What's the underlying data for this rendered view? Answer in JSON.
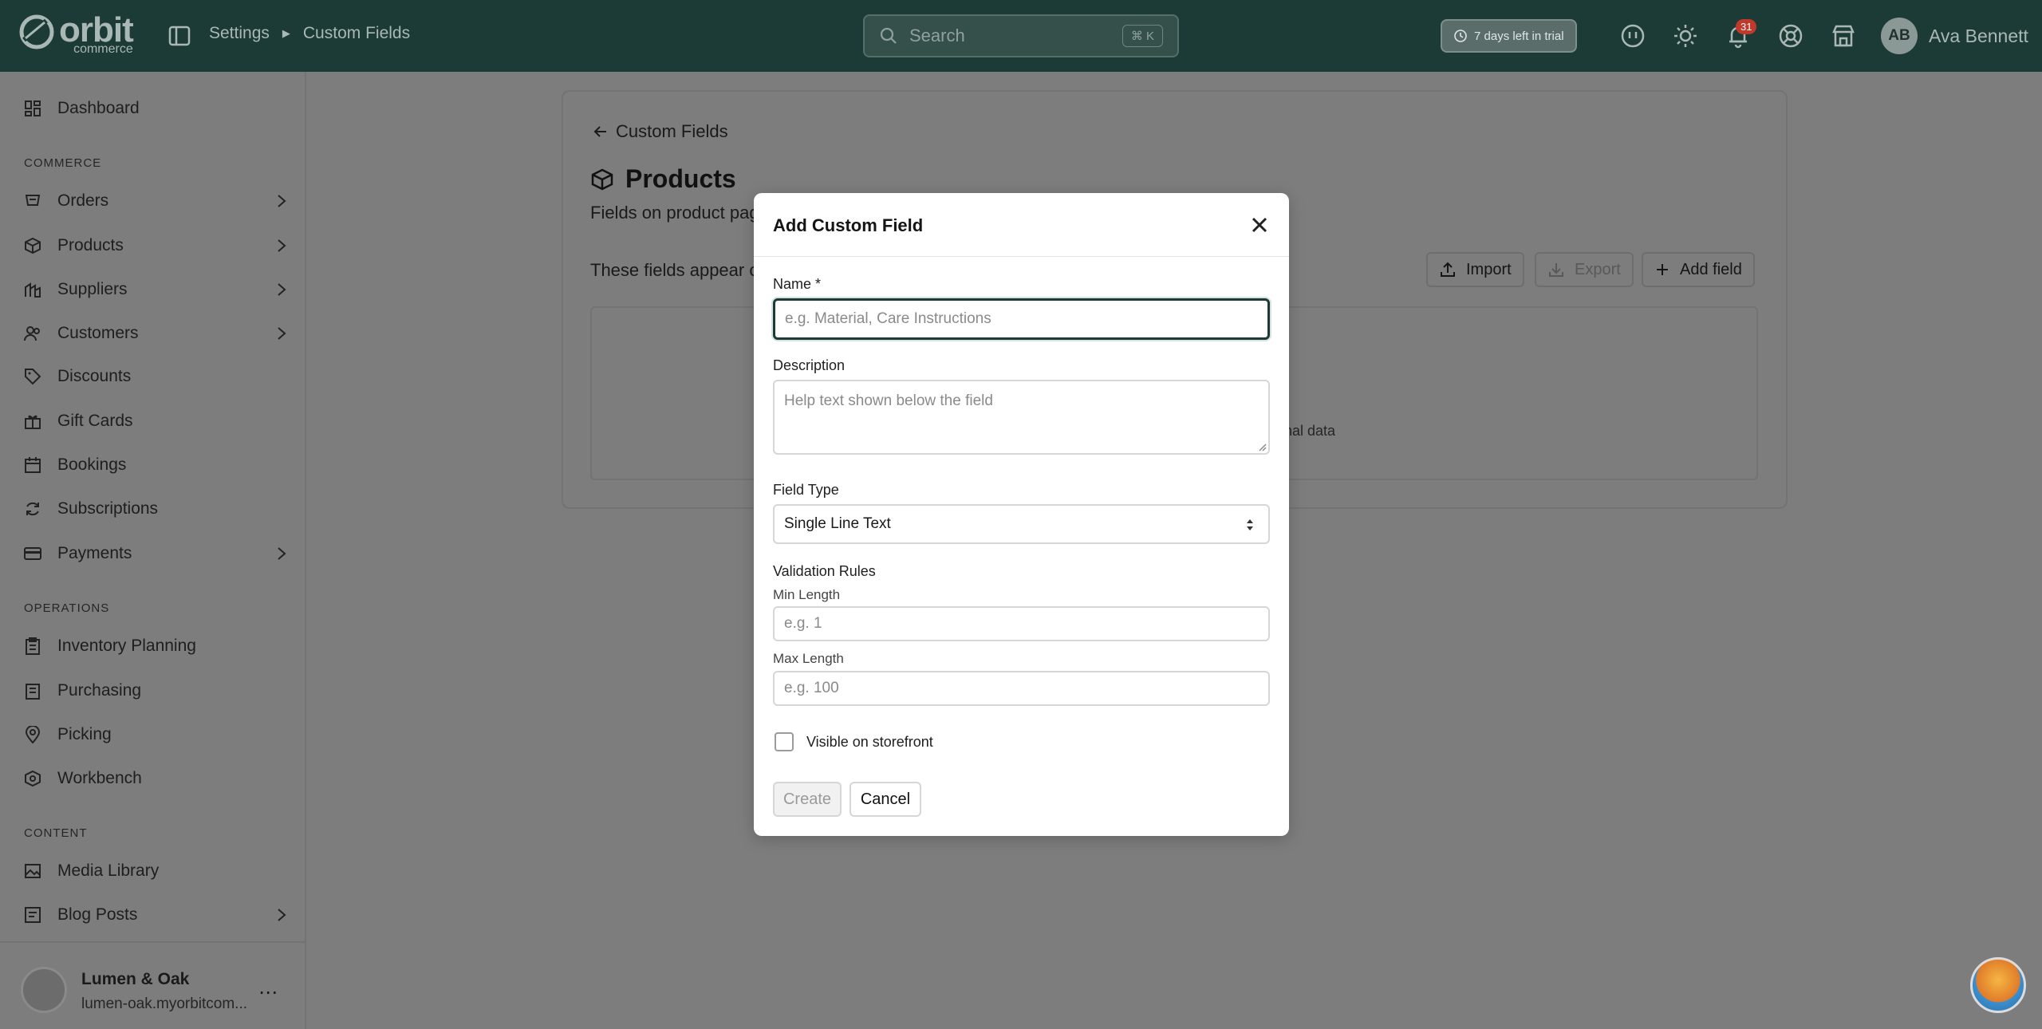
{
  "topbar": {
    "logo_word": "orbit",
    "logo_sub": "commerce",
    "breadcrumb": [
      "Settings",
      "Custom Fields"
    ],
    "search_placeholder": "Search",
    "search_shortcut": "⌘ K",
    "trial_text": "7 days left in trial",
    "notification_count": "31",
    "avatar_initials": "AB",
    "user_name": "Ava Bennett"
  },
  "sidebar": {
    "items": [
      {
        "label": "Dashboard",
        "icon": "dashboard-icon",
        "chevron": false
      },
      {
        "label": "Orders",
        "icon": "orders-icon",
        "chevron": true
      },
      {
        "label": "Products",
        "icon": "products-icon",
        "chevron": true
      },
      {
        "label": "Suppliers",
        "icon": "suppliers-icon",
        "chevron": true
      },
      {
        "label": "Customers",
        "icon": "customers-icon",
        "chevron": true
      },
      {
        "label": "Discounts",
        "icon": "tag-icon",
        "chevron": false
      },
      {
        "label": "Gift Cards",
        "icon": "gift-icon",
        "chevron": false
      },
      {
        "label": "Bookings",
        "icon": "calendar-icon",
        "chevron": false
      },
      {
        "label": "Subscriptions",
        "icon": "refresh-icon",
        "chevron": false
      },
      {
        "label": "Payments",
        "icon": "card-icon",
        "chevron": true
      },
      {
        "label": "Inventory Planning",
        "icon": "clipboard-icon",
        "chevron": false
      },
      {
        "label": "Purchasing",
        "icon": "cart-icon",
        "chevron": false
      },
      {
        "label": "Picking",
        "icon": "pin-icon",
        "chevron": false
      },
      {
        "label": "Workbench",
        "icon": "workbench-icon",
        "chevron": false
      },
      {
        "label": "Media Library",
        "icon": "image-icon",
        "chevron": false
      },
      {
        "label": "Blog Posts",
        "icon": "blog-icon",
        "chevron": true
      }
    ],
    "sections": [
      "COMMERCE",
      "OPERATIONS",
      "CONTENT"
    ],
    "store_name": "Lumen & Oak",
    "store_domain": "lumen-oak.myorbitcom..."
  },
  "page": {
    "back_label": "Custom Fields",
    "title": "Products",
    "subtitle": "Fields on product pag",
    "description": "These fields appear o",
    "import_label": "Import",
    "export_label": "Export",
    "add_field_label": "Add field",
    "empty_text": "onal data"
  },
  "modal": {
    "title": "Add Custom Field",
    "name_label": "Name *",
    "name_placeholder": "e.g. Material, Care Instructions",
    "description_label": "Description",
    "description_placeholder": "Help text shown below the field",
    "field_type_label": "Field Type",
    "field_type_value": "Single Line Text",
    "validation_label": "Validation Rules",
    "min_label": "Min Length",
    "min_placeholder": "e.g. 1",
    "max_label": "Max Length",
    "max_placeholder": "e.g. 100",
    "visible_label": "Visible on storefront",
    "create_label": "Create",
    "cancel_label": "Cancel"
  }
}
